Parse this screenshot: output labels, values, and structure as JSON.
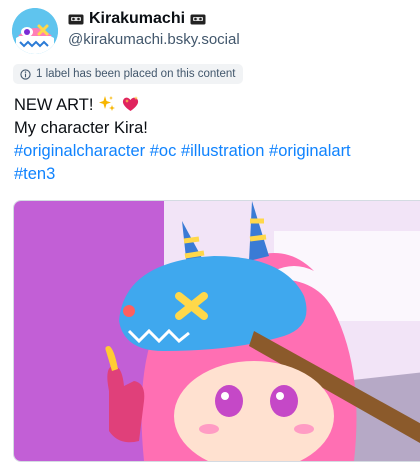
{
  "author": {
    "display_name": "Kirakumachi",
    "handle": "@kirakumachi.bsky.social",
    "name_emoji": "videocassette-icon"
  },
  "moderation": {
    "label_text": "1 label has been placed on this content",
    "icon": "info-icon"
  },
  "post": {
    "line1": "NEW ART!",
    "line1_emoji": [
      "sparkles-icon",
      "sparkling-heart-icon"
    ],
    "line2": "My character Kira!",
    "hashtags_line3": [
      "#originalcharacter",
      "#oc",
      "#illustration",
      "#originalart"
    ],
    "hashtags_line4": [
      "#ten3"
    ]
  },
  "media": {
    "description": "illustration-image"
  },
  "colors": {
    "link": "#1083fe",
    "secondary_text": "#42576c",
    "pill_bg": "#f1f3f5"
  }
}
